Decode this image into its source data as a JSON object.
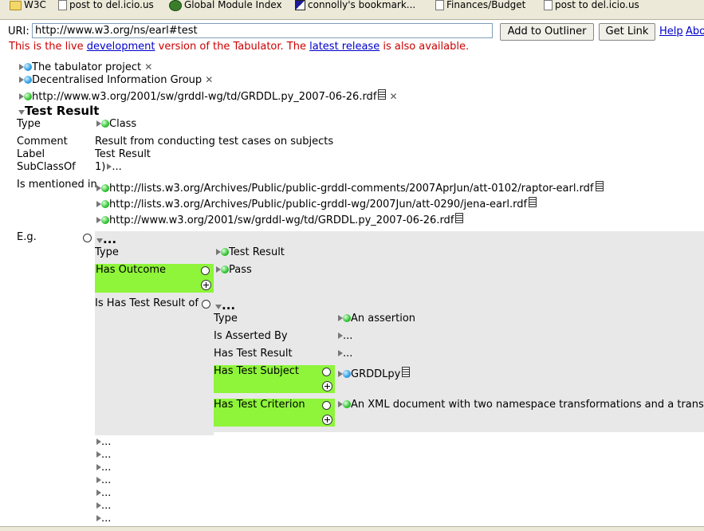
{
  "bookmarks": [
    {
      "label": "W3C",
      "icon": "folder-icon"
    },
    {
      "label": "post to del.icio.us",
      "icon": "page-icon"
    },
    {
      "label": "Global Module Index",
      "icon": "planet-icon"
    },
    {
      "label": "connolly's bookmark...",
      "icon": "cc-icon"
    },
    {
      "label": "Finances/Budget",
      "icon": "page-icon"
    },
    {
      "label": "post to del.icio.us",
      "icon": "page-icon"
    }
  ],
  "uri": {
    "label": "URI:",
    "value": "http://www.w3.org/ns/earl#test"
  },
  "buttons": {
    "add": "Add to Outliner",
    "link": "Get Link"
  },
  "links": {
    "help": "Help",
    "about": "About"
  },
  "notice": {
    "before": "This is the live ",
    "dev": "development",
    "middle": " version of the Tabulator. The ",
    "release": "latest release",
    "after": " is also available."
  },
  "roots": [
    "The tabulator project",
    "Decentralised Information Group",
    "http://www.w3.org/2001/sw/grddl-wg/td/GRDDL.py_2007-06-26.rdf"
  ],
  "subject": {
    "title": "Test Result"
  },
  "props": {
    "type": "Type",
    "type_val": "Class",
    "comment": "Comment",
    "comment_val": "Result from conducting test cases on subjects",
    "label": "Label",
    "label_val": "Test Result",
    "subclass": "SubClassOf",
    "subclass_val": "1)",
    "mentioned": "Is mentioned in",
    "mentions": [
      "http://lists.w3.org/Archives/Public/public-grddl-comments/2007AprJun/att-0102/raptor-earl.rdf",
      "http://lists.w3.org/Archives/Public/public-grddl-wg/2007Jun/att-0290/jena-earl.rdf",
      "http://www.w3.org/2001/sw/grddl-wg/td/GRDDL.py_2007-06-26.rdf"
    ],
    "eg": "E.g."
  },
  "ellipsis": "...",
  "example": {
    "type": "Type",
    "type_val": "Test Result",
    "outcome": "Has Outcome",
    "outcome_val": "Pass",
    "has_result_of": "Is Has Test Result of"
  },
  "assertion": {
    "type": "Type",
    "type_val": "An assertion",
    "asserted_by": "Is Asserted By",
    "has_result": "Has Test Result",
    "subject": "Has Test Subject",
    "subject_val": "GRDDLpy",
    "criterion": "Has Test Criterion",
    "criterion_val": "An XML document with two namespace transformations and a transformation"
  },
  "colors": {
    "highlight": "#8ef53a",
    "nested_bg": "#e8e8e8",
    "notice": "#cc0000",
    "link": "#0000cc"
  }
}
